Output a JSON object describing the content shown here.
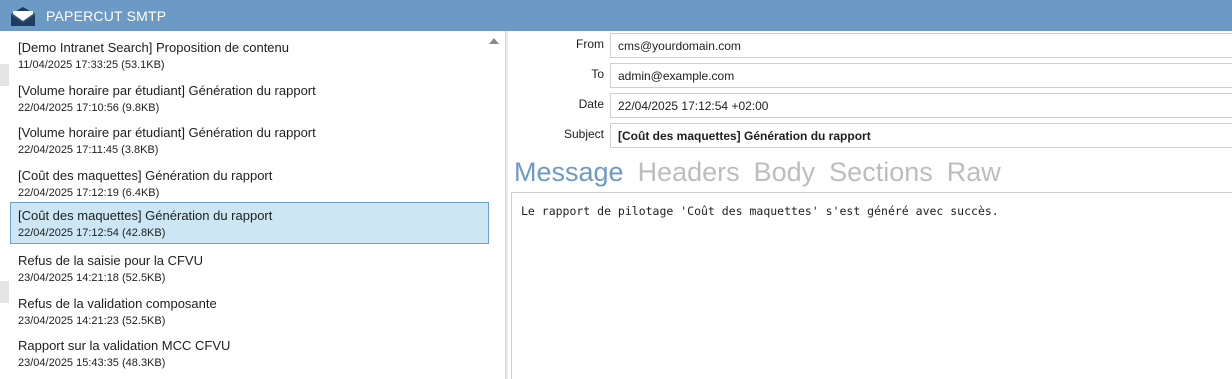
{
  "app": {
    "title": "PAPERCUT SMTP",
    "icon": "envelope-icon"
  },
  "messages": [
    {
      "subject": "[Demo Intranet Search] Proposition de contenu",
      "meta": "11/04/2025 17:33:25 (53.1KB)"
    },
    {
      "subject": "[Volume horaire par étudiant] Génération du rapport",
      "meta": "22/04/2025 17:10:56 (9.8KB)"
    },
    {
      "subject": "[Volume horaire par étudiant] Génération du rapport",
      "meta": "22/04/2025 17:11:45 (3.8KB)"
    },
    {
      "subject": "[Coût des maquettes] Génération du rapport",
      "meta": "22/04/2025 17:12:19 (6.4KB)"
    },
    {
      "subject": "[Coût des maquettes] Génération du rapport",
      "meta": "22/04/2025 17:12:54 (42.8KB)",
      "selected": true
    },
    {
      "subject": "Refus de la saisie pour la CFVU",
      "meta": "23/04/2025 14:21:18 (52.5KB)"
    },
    {
      "subject": "Refus de la validation composante",
      "meta": "23/04/2025 14:21:23 (52.5KB)"
    },
    {
      "subject": "Rapport sur la validation MCC CFVU",
      "meta": "23/04/2025 15:43:35 (48.3KB)"
    }
  ],
  "detail": {
    "from_label": "From",
    "from_value": "cms@yourdomain.com",
    "to_label": "To",
    "to_value": "admin@example.com",
    "date_label": "Date",
    "date_value": "22/04/2025 17:12:54 +02:00",
    "subject_label": "Subject",
    "subject_value": "[Coût des maquettes] Génération du rapport"
  },
  "tabs": [
    "Message",
    "Headers",
    "Body",
    "Sections",
    "Raw"
  ],
  "active_tab": "Message",
  "body_text": "Le rapport de pilotage 'Coût des maquettes' s'est généré avec succès.",
  "colors": {
    "accent": "#6d9ac4",
    "selection": "#cce6f4",
    "selection_border": "#6fa3cf",
    "inactive_tab": "#bdbdbd"
  }
}
